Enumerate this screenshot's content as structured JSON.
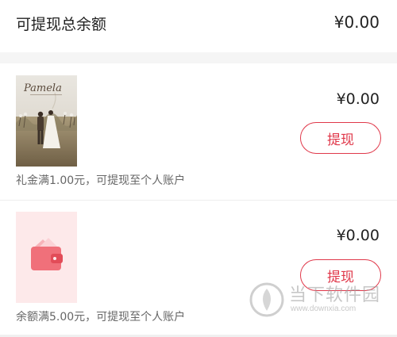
{
  "summary": {
    "label": "可提现总余额",
    "amount": "¥0.00"
  },
  "cards": [
    {
      "id": "gift",
      "image": "wedding-photo",
      "image_text": "Pamela",
      "amount": "¥0.00",
      "button_label": "提现",
      "note": "礼金满1.00元，可提现至个人账户"
    },
    {
      "id": "balance",
      "image": "wallet-icon",
      "amount": "¥0.00",
      "button_label": "提现",
      "note": "余额满5.00元，可提现至个人账户"
    }
  ],
  "watermark": {
    "text": "当下软件园",
    "url": "www.downxia.com"
  },
  "colors": {
    "accent": "#e0384a",
    "wallet": "#f0707a",
    "wallet_bg": "#fde9ea",
    "separator": "#f5f5f5"
  }
}
